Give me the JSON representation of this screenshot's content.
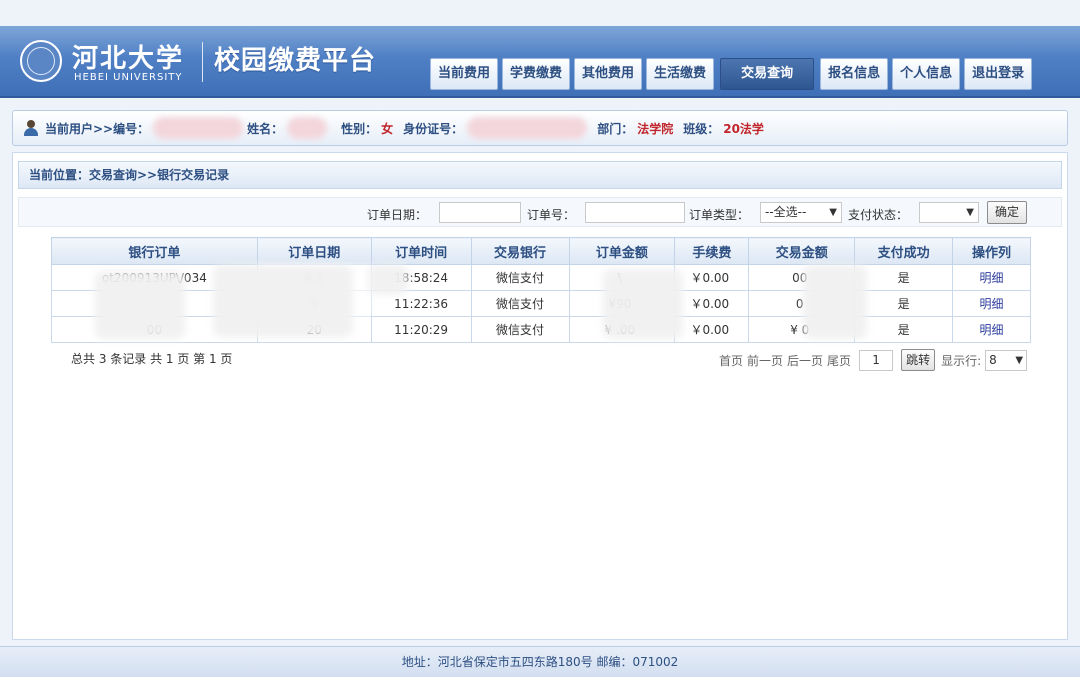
{
  "header": {
    "logo_cn": "河北大学",
    "logo_en": "HEBEI UNIVERSITY",
    "site_title": "校园缴费平台",
    "nav": [
      {
        "label": "当前费用",
        "active": false
      },
      {
        "label": "学费缴费",
        "active": false
      },
      {
        "label": "其他费用",
        "active": false
      },
      {
        "label": "生活缴费",
        "active": false
      },
      {
        "label": "交易查询",
        "active": true
      },
      {
        "label": "报名信息",
        "active": false
      },
      {
        "label": "个人信息",
        "active": false
      },
      {
        "label": "退出登录",
        "active": false
      }
    ]
  },
  "userbar": {
    "current_user_label": "当前用户>>编号：",
    "name_label": "姓名：",
    "gender_label": "性别：",
    "gender_value": "女",
    "id_label": "身份证号：",
    "dept_label": "部门：",
    "dept_value": "法学院",
    "class_label": "班级：",
    "class_value": "20法学"
  },
  "breadcrumb": "当前位置：交易查询>>银行交易记录",
  "filters": {
    "order_date_label": "订单日期：",
    "order_no_label": "订单号：",
    "order_type_label": "订单类型：",
    "order_type_value": "--全选--",
    "pay_status_label": "支付状态：",
    "pay_status_value": "",
    "confirm_label": "确定"
  },
  "table": {
    "columns": [
      "银行订单",
      "订单日期",
      "订单时间",
      "交易银行",
      "订单金额",
      "手续费",
      "交易金额",
      "支付成功",
      "操作列"
    ],
    "rows": [
      {
        "bank_order": "ot200913UP\\/034",
        "date": "    0  1",
        "time": "18:58:24",
        "bank": "微信支付",
        "amount": "\\",
        "fee": "￥0.00",
        "trade_amount": "00",
        "success": "是",
        "action": "明细"
      },
      {
        "bank_order": "",
        "date": "      5",
        "time": "11:22:36",
        "bank": "微信支付",
        "amount": "¥90",
        "fee": "￥0.00",
        "trade_amount": "0",
        "success": "是",
        "action": "明细"
      },
      {
        "bank_order": "      00",
        "date": "20",
        "time": "11:20:29",
        "bank": "微信支付",
        "amount": "¥     .00",
        "fee": "￥0.00",
        "trade_amount": "¥     0",
        "success": "是",
        "action": "明细"
      }
    ]
  },
  "summary": "总共 3 条记录   共 1 页   第 1 页",
  "pager": {
    "first": "首页",
    "prev": "前一页",
    "next": "后一页",
    "last": "尾页",
    "page_value": "1",
    "jump_label": "跳转",
    "rows_label": "显示行:",
    "rows_value": "8"
  },
  "footer": "地址：河北省保定市五四东路180号 邮编：071002"
}
